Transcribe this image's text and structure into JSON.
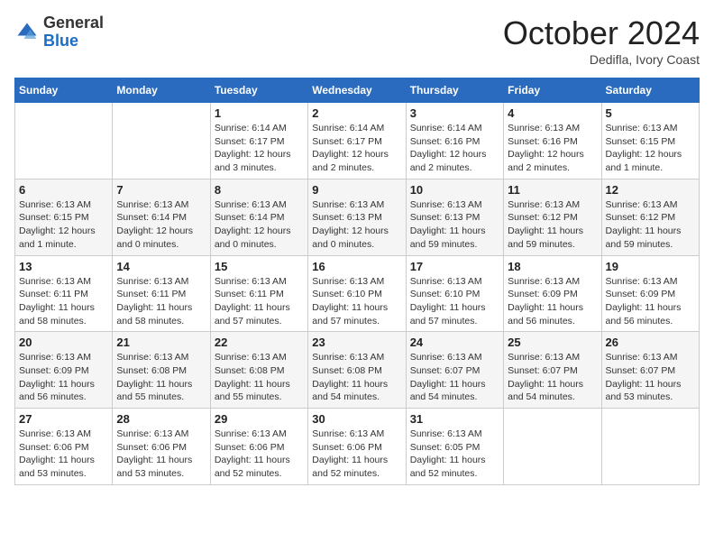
{
  "logo": {
    "general": "General",
    "blue": "Blue"
  },
  "title": "October 2024",
  "location": "Dedifla, Ivory Coast",
  "days_header": [
    "Sunday",
    "Monday",
    "Tuesday",
    "Wednesday",
    "Thursday",
    "Friday",
    "Saturday"
  ],
  "weeks": [
    [
      {
        "day": "",
        "sunrise": "",
        "sunset": "",
        "daylight": ""
      },
      {
        "day": "",
        "sunrise": "",
        "sunset": "",
        "daylight": ""
      },
      {
        "day": "1",
        "sunrise": "Sunrise: 6:14 AM",
        "sunset": "Sunset: 6:17 PM",
        "daylight": "Daylight: 12 hours and 3 minutes."
      },
      {
        "day": "2",
        "sunrise": "Sunrise: 6:14 AM",
        "sunset": "Sunset: 6:17 PM",
        "daylight": "Daylight: 12 hours and 2 minutes."
      },
      {
        "day": "3",
        "sunrise": "Sunrise: 6:14 AM",
        "sunset": "Sunset: 6:16 PM",
        "daylight": "Daylight: 12 hours and 2 minutes."
      },
      {
        "day": "4",
        "sunrise": "Sunrise: 6:13 AM",
        "sunset": "Sunset: 6:16 PM",
        "daylight": "Daylight: 12 hours and 2 minutes."
      },
      {
        "day": "5",
        "sunrise": "Sunrise: 6:13 AM",
        "sunset": "Sunset: 6:15 PM",
        "daylight": "Daylight: 12 hours and 1 minute."
      }
    ],
    [
      {
        "day": "6",
        "sunrise": "Sunrise: 6:13 AM",
        "sunset": "Sunset: 6:15 PM",
        "daylight": "Daylight: 12 hours and 1 minute."
      },
      {
        "day": "7",
        "sunrise": "Sunrise: 6:13 AM",
        "sunset": "Sunset: 6:14 PM",
        "daylight": "Daylight: 12 hours and 0 minutes."
      },
      {
        "day": "8",
        "sunrise": "Sunrise: 6:13 AM",
        "sunset": "Sunset: 6:14 PM",
        "daylight": "Daylight: 12 hours and 0 minutes."
      },
      {
        "day": "9",
        "sunrise": "Sunrise: 6:13 AM",
        "sunset": "Sunset: 6:13 PM",
        "daylight": "Daylight: 12 hours and 0 minutes."
      },
      {
        "day": "10",
        "sunrise": "Sunrise: 6:13 AM",
        "sunset": "Sunset: 6:13 PM",
        "daylight": "Daylight: 11 hours and 59 minutes."
      },
      {
        "day": "11",
        "sunrise": "Sunrise: 6:13 AM",
        "sunset": "Sunset: 6:12 PM",
        "daylight": "Daylight: 11 hours and 59 minutes."
      },
      {
        "day": "12",
        "sunrise": "Sunrise: 6:13 AM",
        "sunset": "Sunset: 6:12 PM",
        "daylight": "Daylight: 11 hours and 59 minutes."
      }
    ],
    [
      {
        "day": "13",
        "sunrise": "Sunrise: 6:13 AM",
        "sunset": "Sunset: 6:11 PM",
        "daylight": "Daylight: 11 hours and 58 minutes."
      },
      {
        "day": "14",
        "sunrise": "Sunrise: 6:13 AM",
        "sunset": "Sunset: 6:11 PM",
        "daylight": "Daylight: 11 hours and 58 minutes."
      },
      {
        "day": "15",
        "sunrise": "Sunrise: 6:13 AM",
        "sunset": "Sunset: 6:11 PM",
        "daylight": "Daylight: 11 hours and 57 minutes."
      },
      {
        "day": "16",
        "sunrise": "Sunrise: 6:13 AM",
        "sunset": "Sunset: 6:10 PM",
        "daylight": "Daylight: 11 hours and 57 minutes."
      },
      {
        "day": "17",
        "sunrise": "Sunrise: 6:13 AM",
        "sunset": "Sunset: 6:10 PM",
        "daylight": "Daylight: 11 hours and 57 minutes."
      },
      {
        "day": "18",
        "sunrise": "Sunrise: 6:13 AM",
        "sunset": "Sunset: 6:09 PM",
        "daylight": "Daylight: 11 hours and 56 minutes."
      },
      {
        "day": "19",
        "sunrise": "Sunrise: 6:13 AM",
        "sunset": "Sunset: 6:09 PM",
        "daylight": "Daylight: 11 hours and 56 minutes."
      }
    ],
    [
      {
        "day": "20",
        "sunrise": "Sunrise: 6:13 AM",
        "sunset": "Sunset: 6:09 PM",
        "daylight": "Daylight: 11 hours and 56 minutes."
      },
      {
        "day": "21",
        "sunrise": "Sunrise: 6:13 AM",
        "sunset": "Sunset: 6:08 PM",
        "daylight": "Daylight: 11 hours and 55 minutes."
      },
      {
        "day": "22",
        "sunrise": "Sunrise: 6:13 AM",
        "sunset": "Sunset: 6:08 PM",
        "daylight": "Daylight: 11 hours and 55 minutes."
      },
      {
        "day": "23",
        "sunrise": "Sunrise: 6:13 AM",
        "sunset": "Sunset: 6:08 PM",
        "daylight": "Daylight: 11 hours and 54 minutes."
      },
      {
        "day": "24",
        "sunrise": "Sunrise: 6:13 AM",
        "sunset": "Sunset: 6:07 PM",
        "daylight": "Daylight: 11 hours and 54 minutes."
      },
      {
        "day": "25",
        "sunrise": "Sunrise: 6:13 AM",
        "sunset": "Sunset: 6:07 PM",
        "daylight": "Daylight: 11 hours and 54 minutes."
      },
      {
        "day": "26",
        "sunrise": "Sunrise: 6:13 AM",
        "sunset": "Sunset: 6:07 PM",
        "daylight": "Daylight: 11 hours and 53 minutes."
      }
    ],
    [
      {
        "day": "27",
        "sunrise": "Sunrise: 6:13 AM",
        "sunset": "Sunset: 6:06 PM",
        "daylight": "Daylight: 11 hours and 53 minutes."
      },
      {
        "day": "28",
        "sunrise": "Sunrise: 6:13 AM",
        "sunset": "Sunset: 6:06 PM",
        "daylight": "Daylight: 11 hours and 53 minutes."
      },
      {
        "day": "29",
        "sunrise": "Sunrise: 6:13 AM",
        "sunset": "Sunset: 6:06 PM",
        "daylight": "Daylight: 11 hours and 52 minutes."
      },
      {
        "day": "30",
        "sunrise": "Sunrise: 6:13 AM",
        "sunset": "Sunset: 6:06 PM",
        "daylight": "Daylight: 11 hours and 52 minutes."
      },
      {
        "day": "31",
        "sunrise": "Sunrise: 6:13 AM",
        "sunset": "Sunset: 6:05 PM",
        "daylight": "Daylight: 11 hours and 52 minutes."
      },
      {
        "day": "",
        "sunrise": "",
        "sunset": "",
        "daylight": ""
      },
      {
        "day": "",
        "sunrise": "",
        "sunset": "",
        "daylight": ""
      }
    ]
  ]
}
